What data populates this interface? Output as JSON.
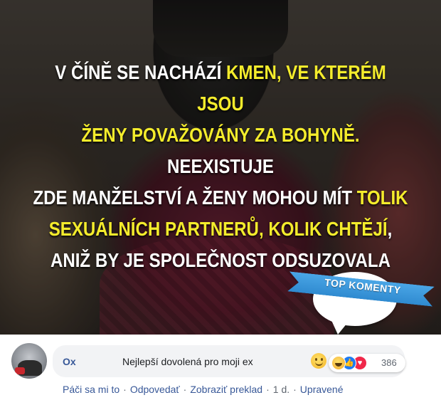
{
  "post_image": {
    "caption_lines": [
      [
        {
          "text": "V Číně se nachází ",
          "hl": false
        },
        {
          "text": "kmen, ve kterém jsou",
          "hl": true
        }
      ],
      [
        {
          "text": "ženy považovány za bohyně.",
          "hl": true
        },
        {
          "text": " Neexistuje",
          "hl": false
        }
      ],
      [
        {
          "text": "zde manželství a ženy mohou mít ",
          "hl": false
        },
        {
          "text": "tolik",
          "hl": true
        }
      ],
      [
        {
          "text": "sexuálních partnerů, kolik chtějí",
          "hl": true
        },
        {
          "text": ",",
          "hl": false
        }
      ],
      [
        {
          "text": "aniž by je společnost odsuzovala",
          "hl": false
        }
      ]
    ],
    "badge_label": "TOP KOMENTY",
    "colors": {
      "highlight": "#f4ec2c",
      "text": "#ffffff",
      "badge": "#2f8ad0"
    }
  },
  "comment": {
    "author": "Ox",
    "text": "Nejlepší dovolená pro moji ex",
    "emoji": "slightly-smiling-face-icon",
    "reactions": {
      "icons": [
        "haha-icon",
        "like-icon",
        "love-icon"
      ],
      "count": "386"
    },
    "actions": [
      {
        "label": "Páči sa mi to",
        "link": true
      },
      {
        "label": "Odpovedať",
        "link": true
      },
      {
        "label": "Zobraziť preklad",
        "link": true
      },
      {
        "label": "1 d.",
        "link": false
      },
      {
        "label": "Upravené",
        "link": true
      }
    ],
    "colors": {
      "author": "#385898",
      "bubble": "#f2f3f5",
      "meta": "#606770"
    }
  }
}
